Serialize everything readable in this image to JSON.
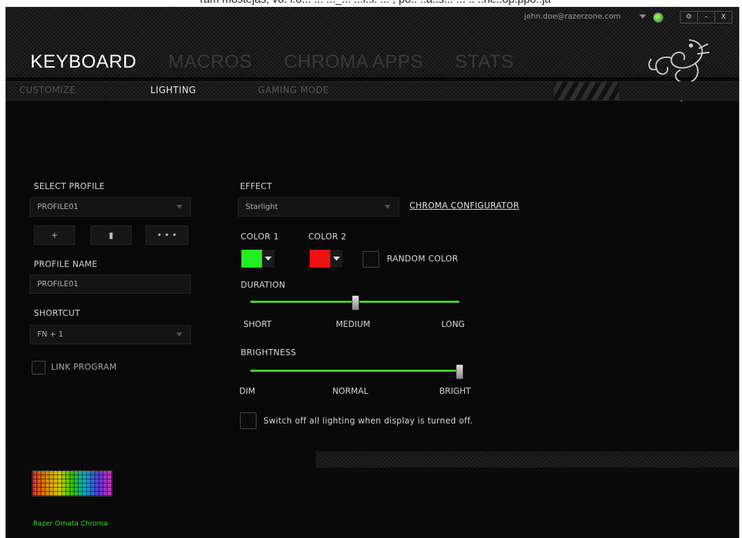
{
  "page_top_text": "ram mostejas, vo. i.o... ... ..._... ...i..i. ... , po.. ..a..s... ... .. ..ne..op.ppo..ja",
  "header": {
    "user_email": "john.doe@razerzone.com",
    "window_buttons": [
      "⚙",
      "–",
      "X"
    ]
  },
  "main_nav": [
    "KEYBOARD",
    "MACROS",
    "CHROMA APPS",
    "STATS"
  ],
  "sub_nav": [
    "CUSTOMIZE",
    "LIGHTING",
    "GAMING MODE"
  ],
  "profile": {
    "select_label": "SELECT PROFILE",
    "selected": "PROFILE01",
    "buttons": [
      "+",
      "▮",
      "• • •"
    ],
    "name_label": "PROFILE NAME",
    "name_value": "PROFILE01",
    "shortcut_label": "SHORTCUT",
    "shortcut_value": "FN + 1",
    "link_program_label": "LINK PROGRAM"
  },
  "lighting": {
    "effect_label": "EFFECT",
    "effect_value": "Starlight",
    "chroma_link": "CHROMA CONFIGURATOR",
    "color1_label": "COLOR 1",
    "color2_label": "COLOR 2",
    "color1": "#22ee22",
    "color2": "#ee1111",
    "random_label": "RANDOM COLOR",
    "duration_label": "DURATION",
    "duration_ticks": [
      "SHORT",
      "MEDIUM",
      "LONG"
    ],
    "duration_level": 0.5,
    "brightness_label": "BRIGHTNESS",
    "brightness_ticks": [
      "DIM",
      "NORMAL",
      "BRIGHT"
    ],
    "brightness_level": 1.0,
    "switch_off_label": "Switch off all lighting when display is turned off."
  },
  "footer": {
    "device_name": "Razer Ornata Chroma"
  },
  "colors": {
    "accent": "#44d62c",
    "background": "#080808"
  }
}
